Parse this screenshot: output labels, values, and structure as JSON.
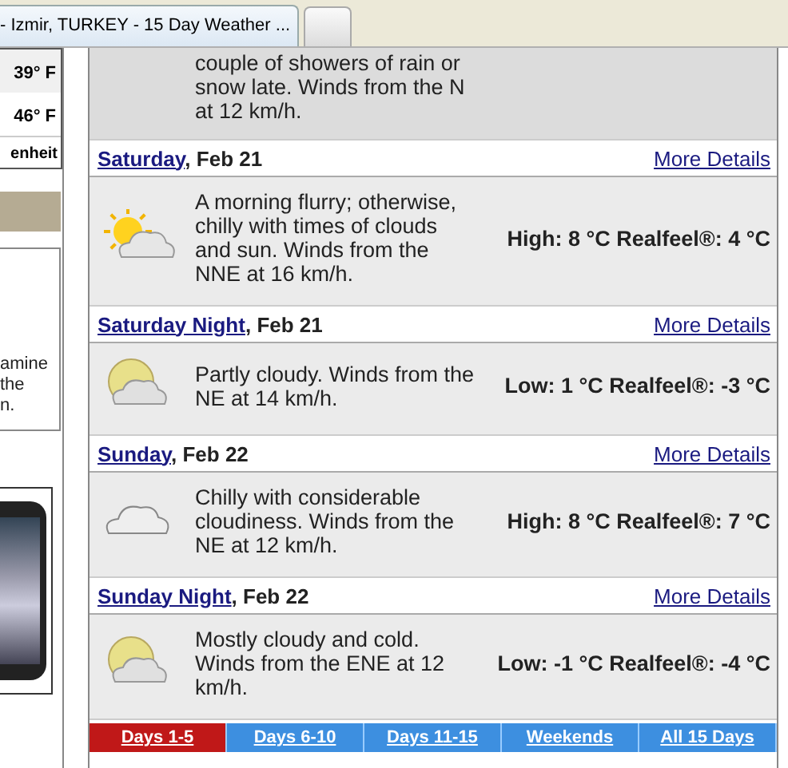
{
  "browser_tab": {
    "title": "- Izmir, TURKEY - 15 Day Weather ..."
  },
  "sidebar": {
    "temps": [
      "39° F",
      "46° F"
    ],
    "unit_text": "enheit",
    "promo_lines": [
      "amine",
      "the",
      "n."
    ]
  },
  "forecast": {
    "partial_description": "couple of showers of rain or snow late. Winds from the N at 12 km/h.",
    "periods": [
      {
        "day": "Saturday",
        "date": ", Feb 21",
        "link": "More Details",
        "kind": "partly-sunny",
        "description": "A morning flurry; otherwise, chilly with times of clouds and sun. Winds from the NNE at 16 km/h.",
        "temps": "High: 8 °C Realfeel®: 4 °C"
      },
      {
        "day": "Saturday Night",
        "date": ", Feb 21",
        "link": "More Details",
        "kind": "partly-cloudy-night",
        "description": "Partly cloudy. Winds from the NE at 14 km/h.",
        "temps": "Low: 1 °C Realfeel®: -3 °C"
      },
      {
        "day": "Sunday",
        "date": ", Feb 22",
        "link": "More Details",
        "kind": "cloudy",
        "description": "Chilly with considerable cloudiness. Winds from the NE at 12 km/h.",
        "temps": "High: 8 °C Realfeel®: 7 °C"
      },
      {
        "day": "Sunday Night",
        "date": ", Feb 22",
        "link": "More Details",
        "kind": "mostly-cloudy-night",
        "description": "Mostly cloudy and cold. Winds from the ENE at 12 km/h.",
        "temps": "Low: -1 °C Realfeel®: -4 °C"
      }
    ]
  },
  "range_tabs": [
    {
      "label": "Days 1-5",
      "selected": true
    },
    {
      "label": "Days 6-10",
      "selected": false
    },
    {
      "label": "Days 11-15",
      "selected": false
    },
    {
      "label": "Weekends",
      "selected": false
    },
    {
      "label": "All 15 Days",
      "selected": false
    }
  ]
}
